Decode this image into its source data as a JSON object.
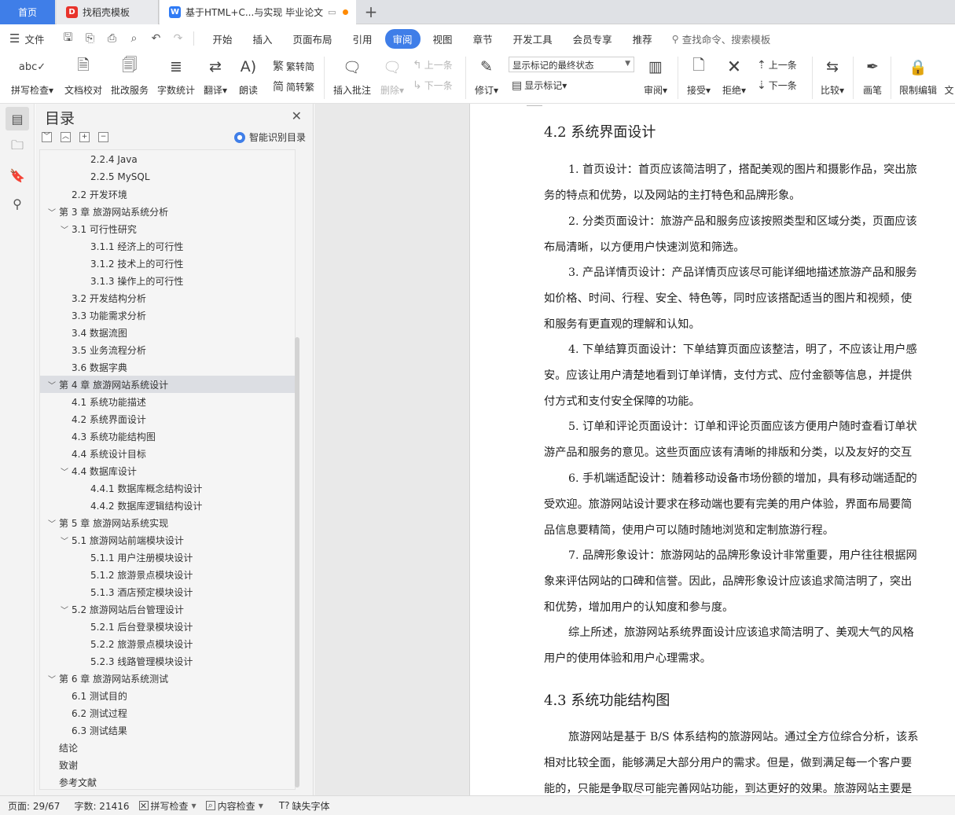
{
  "tabs": {
    "home": "首页",
    "doc1": "找稻壳模板",
    "doc2": "基于HTML+C...与实现 毕业论文",
    "add": "+"
  },
  "menubar": {
    "file": "文件",
    "items": [
      "开始",
      "插入",
      "页面布局",
      "引用",
      "审阅",
      "视图",
      "章节",
      "开发工具",
      "会员专享",
      "推荐"
    ],
    "active": "审阅",
    "search_placeholder": "查找命令、搜索模板"
  },
  "ribbon": {
    "spell_check": "拼写检查",
    "doc_proof": "文档校对",
    "batch_service": "批改服务",
    "word_count": "字数统计",
    "translate": "翻译",
    "read_aloud": "朗读",
    "trad_to_simp": "繁转简",
    "simp_to_trad": "简转繁",
    "insert_comment": "插入批注",
    "delete": "删除",
    "prev": "上一条",
    "next": "下一条",
    "revise": "修订",
    "markup_mode": "显示标记的最终状态",
    "show_markup": "显示标记",
    "review": "审阅",
    "accept": "接受",
    "reject": "拒绝",
    "prev2": "上一条",
    "next2": "下一条",
    "compare": "比较",
    "pen": "画笔",
    "restrict_edit": "限制编辑",
    "doc_rights": "文"
  },
  "toc": {
    "title": "目录",
    "smart_label": "智能识别目录",
    "items": [
      {
        "label": "2.2.4 Java",
        "level": 3,
        "chev": ""
      },
      {
        "label": "2.2.5 MySQL",
        "level": 3,
        "chev": ""
      },
      {
        "label": "2.2 开发环境",
        "level": 2,
        "chev": ""
      },
      {
        "label": "第 3 章 旅游网站系统分析",
        "level": 1,
        "chev": "﹀"
      },
      {
        "label": "3.1 可行性研究",
        "level": 2,
        "chev": "﹀"
      },
      {
        "label": "3.1.1 经济上的可行性",
        "level": 3,
        "chev": ""
      },
      {
        "label": "3.1.2 技术上的可行性",
        "level": 3,
        "chev": ""
      },
      {
        "label": "3.1.3 操作上的可行性",
        "level": 3,
        "chev": ""
      },
      {
        "label": "3.2 开发结构分析",
        "level": 2,
        "chev": ""
      },
      {
        "label": "3.3 功能需求分析",
        "level": 2,
        "chev": ""
      },
      {
        "label": "3.4 数据流图",
        "level": 2,
        "chev": ""
      },
      {
        "label": "3.5 业务流程分析",
        "level": 2,
        "chev": ""
      },
      {
        "label": "3.6 数据字典",
        "level": 2,
        "chev": ""
      },
      {
        "label": "第 4 章 旅游网站系统设计",
        "level": 1,
        "chev": "﹀"
      },
      {
        "label": "4.1 系统功能描述",
        "level": 2,
        "chev": ""
      },
      {
        "label": "4.2 系统界面设计",
        "level": 2,
        "chev": ""
      },
      {
        "label": "4.3 系统功能结构图",
        "level": 2,
        "chev": ""
      },
      {
        "label": "4.4 系统设计目标",
        "level": 2,
        "chev": ""
      },
      {
        "label": "4.4 数据库设计",
        "level": 2,
        "chev": "﹀"
      },
      {
        "label": "4.4.1 数据库概念结构设计",
        "level": 3,
        "chev": ""
      },
      {
        "label": "4.4.2 数据库逻辑结构设计",
        "level": 3,
        "chev": ""
      },
      {
        "label": "第 5 章 旅游网站系统实现",
        "level": 1,
        "chev": "﹀"
      },
      {
        "label": "5.1 旅游网站前端模块设计",
        "level": 2,
        "chev": "﹀"
      },
      {
        "label": "5.1.1 用户注册模块设计",
        "level": 3,
        "chev": ""
      },
      {
        "label": "5.1.2 旅游景点模块设计",
        "level": 3,
        "chev": ""
      },
      {
        "label": "5.1.3 酒店预定模块设计",
        "level": 3,
        "chev": ""
      },
      {
        "label": "5.2 旅游网站后台管理设计",
        "level": 2,
        "chev": "﹀"
      },
      {
        "label": "5.2.1 后台登录模块设计",
        "level": 3,
        "chev": ""
      },
      {
        "label": "5.2.2 旅游景点模块设计",
        "level": 3,
        "chev": ""
      },
      {
        "label": "5.2.3 线路管理模块设计",
        "level": 3,
        "chev": ""
      },
      {
        "label": "第 6 章 旅游网站系统测试",
        "level": 1,
        "chev": "﹀"
      },
      {
        "label": "6.1 测试目的",
        "level": 2,
        "chev": ""
      },
      {
        "label": "6.2 测试过程",
        "level": 2,
        "chev": ""
      },
      {
        "label": "6.3 测试结果",
        "level": 2,
        "chev": ""
      },
      {
        "label": "结论",
        "level": 1,
        "chev": ""
      },
      {
        "label": "致谢",
        "level": 1,
        "chev": ""
      },
      {
        "label": "参考文献",
        "level": 1,
        "chev": ""
      }
    ],
    "selected_index": 13
  },
  "document": {
    "heading_42": "4.2 系统界面设计",
    "para1": [
      "1. 首页设计：首页应该简洁明了，搭配美观的图片和摄影作品，突出旅",
      "务的特点和优势，以及网站的主打特色和品牌形象。"
    ],
    "para2": [
      "2. 分类页面设计：旅游产品和服务应该按照类型和区域分类，页面应该",
      "布局清晰，以方便用户快速浏览和筛选。"
    ],
    "para3": [
      "3. 产品详情页设计：产品详情页应该尽可能详细地描述旅游产品和服务",
      "如价格、时间、行程、安全、特色等，同时应该搭配适当的图片和视频，使",
      "和服务有更直观的理解和认知。"
    ],
    "para4": [
      "4. 下单结算页面设计：下单结算页面应该整洁，明了，不应该让用户感",
      "安。应该让用户清楚地看到订单详情，支付方式、应付金额等信息，并提供",
      "付方式和支付安全保障的功能。"
    ],
    "para5": [
      "5. 订单和评论页面设计：订单和评论页面应该方便用户随时查看订单状",
      "游产品和服务的意见。这些页面应该有清晰的排版和分类，以及友好的交互"
    ],
    "para6": [
      "6. 手机端适配设计：随着移动设备市场份额的增加，具有移动端适配的",
      "受欢迎。旅游网站设计要求在移动端也要有完美的用户体验，界面布局要简",
      "品信息要精简，使用户可以随时随地浏览和定制旅游行程。"
    ],
    "para7": [
      "7. 品牌形象设计：旅游网站的品牌形象设计非常重要，用户往往根据网",
      "象来评估网站的口碑和信誉。因此，品牌形象设计应该追求简洁明了，突出",
      "和优势，增加用户的认知度和参与度。"
    ],
    "para8": [
      "综上所述，旅游网站系统界面设计应该追求简洁明了、美观大气的风格",
      "用户的使用体验和用户心理需求。"
    ],
    "heading_43": "4.3 系统功能结构图",
    "para9": [
      "旅游网站是基于 B/S 体系结构的旅游网站。通过全方位综合分析，该系",
      "相对比较全面，能够满足大部分用户的需求。但是，做到满足每一个客户要",
      "能的，只能是争取尽可能完善网站功能，到达更好的效果。旅游网站主要是"
    ]
  },
  "status": {
    "page": "页面: 29/67",
    "words": "字数: 21416",
    "spell": "拼写检查",
    "content_check": "内容检查",
    "missing_font": "缺失字体"
  },
  "colors": {
    "accent": "#3f7ee8",
    "home_tab": "#3f7ee8"
  }
}
